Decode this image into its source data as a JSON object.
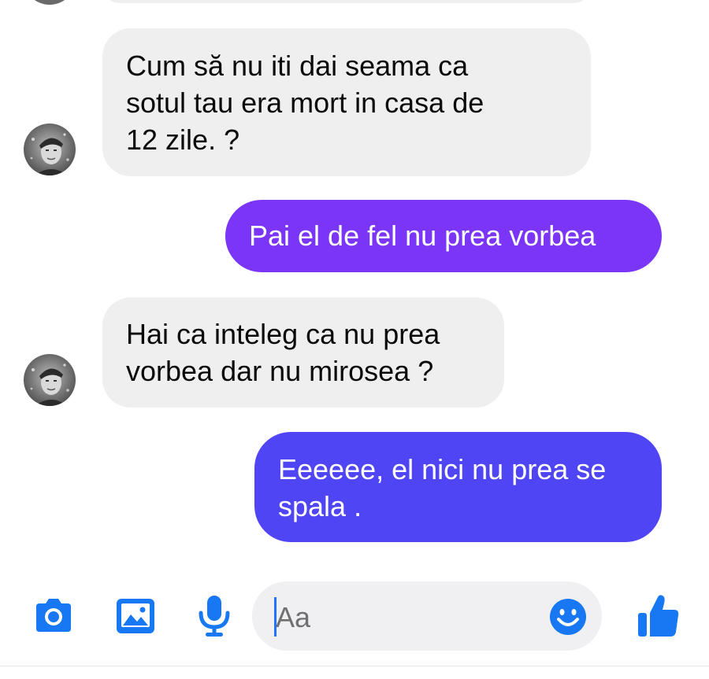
{
  "conversation": {
    "messages": [
      {
        "from": "contact",
        "text": "Cum să nu iti dai seama ca\nsotul tau era mort in casa de\n12 zile. ?"
      },
      {
        "from": "me",
        "text": "Pai el de fel nu prea vorbea"
      },
      {
        "from": "contact",
        "text": "Hai ca inteleg ca nu prea\nvorbea dar nu mirosea ?"
      },
      {
        "from": "me",
        "text": "Eeeeee, el nici nu prea se\nspala ."
      }
    ]
  },
  "composer": {
    "placeholder": "Aa",
    "icons": [
      "camera-icon",
      "gallery-icon",
      "microphone-icon",
      "emoji-icon",
      "thumbs-up-icon"
    ]
  },
  "colors": {
    "accent": "#1877f2",
    "incoming_bubble": "#efeff0",
    "outgoing_bubble_1": "#7a35f6",
    "outgoing_bubble_2": "#5045f4"
  }
}
